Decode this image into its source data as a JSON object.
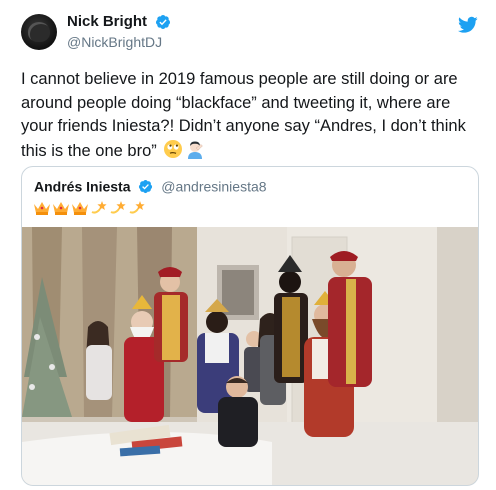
{
  "tweet": {
    "author_name": "Nick Bright",
    "author_handle": "@NickBrightDJ",
    "text": "I cannot believe in 2019 famous people are still doing or are around people doing “blackface” and tweeting it, where are your friends Iniesta?! Didn’t anyone say “Andres, I don’t think this is the one bro” ",
    "trailing_emojis": [
      "face-with-rolling-eyes",
      "man-facepalming"
    ]
  },
  "quoted_tweet": {
    "author_name": "Andrés Iniesta",
    "author_handle": "@andresiniesta8",
    "emojis": [
      "crown",
      "crown",
      "crown",
      "dizzy",
      "dizzy",
      "dizzy"
    ]
  },
  "icons": {
    "verified": "verified-badge-icon",
    "brand": "twitter-bird-icon"
  },
  "colors": {
    "twitter_blue": "#1da1f2",
    "handle_gray": "#657786",
    "border": "#ccd6dd",
    "text": "#14171a"
  }
}
